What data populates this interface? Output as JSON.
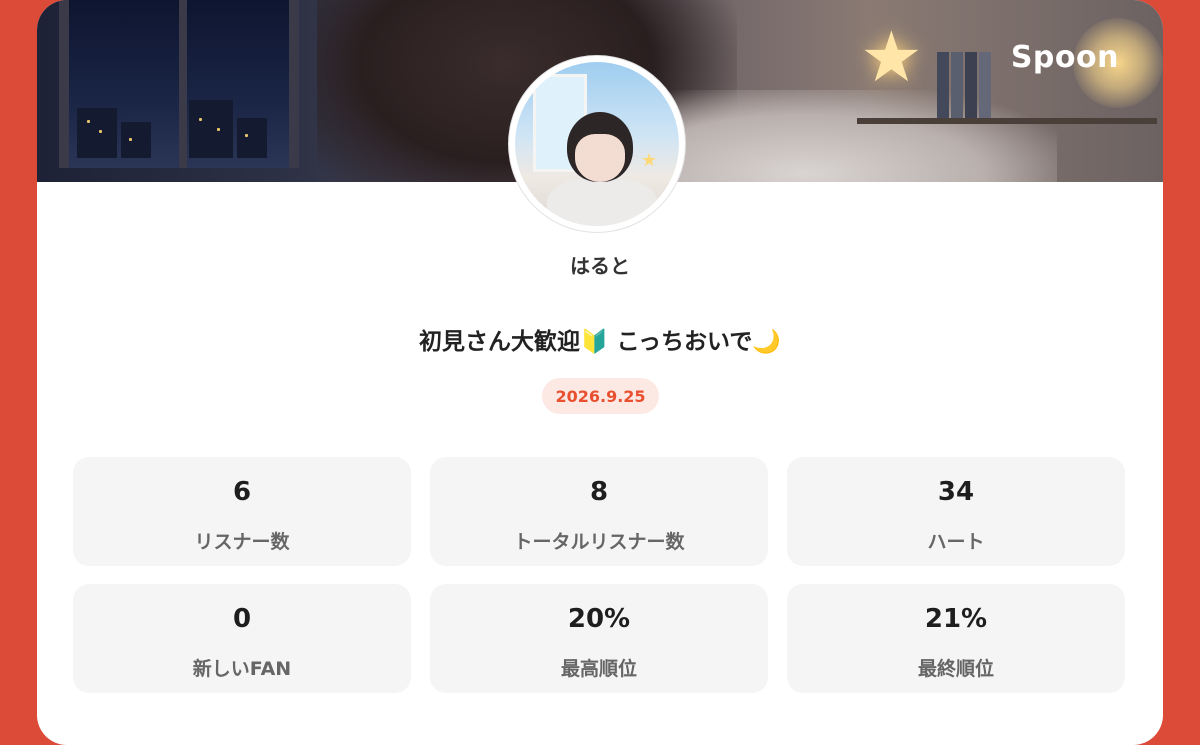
{
  "brand": {
    "logo_text": "Spoon",
    "accent": "#dc4a38"
  },
  "profile": {
    "username": "はると",
    "avatar_icon": "avatar-image"
  },
  "room": {
    "title": "初見さん大歓迎🔰 こっちおいで🌙",
    "date": "2026.9.25"
  },
  "stats": [
    {
      "value": "6",
      "label": "リスナー数"
    },
    {
      "value": "8",
      "label": "トータルリスナー数"
    },
    {
      "value": "34",
      "label": "ハート"
    },
    {
      "value": "0",
      "label": "新しいFAN"
    },
    {
      "value": "20%",
      "label": "最高順位"
    },
    {
      "value": "21%",
      "label": "最終順位"
    }
  ]
}
